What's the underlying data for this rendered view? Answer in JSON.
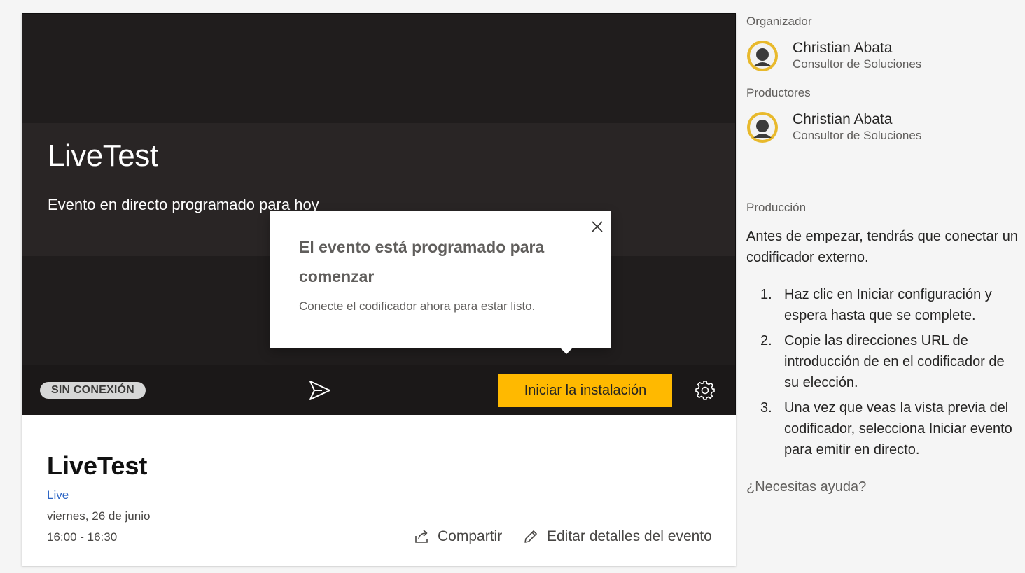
{
  "player": {
    "banner_title": "LiveTest",
    "banner_subtitle": "Evento en directo programado para hoy",
    "status": "SIN CONEXIÓN",
    "start_button": "Iniciar la instalación",
    "accent": "#ffb900"
  },
  "popup": {
    "title": "El evento está programado para comenzar",
    "text": "Conecte el codificador ahora para estar listo."
  },
  "event": {
    "title": "LiveTest",
    "type": "Live",
    "date": "viernes, 26 de junio",
    "time": "16:00 - 16:30",
    "share_label": "Compartir",
    "edit_label": "Editar detalles del evento"
  },
  "side": {
    "organizer_label": "Organizador",
    "organizer": {
      "name": "Christian Abata",
      "role": "Consultor de Soluciones"
    },
    "producers_label": "Productores",
    "producer": {
      "name": "Christian Abata",
      "role": "Consultor de Soluciones"
    },
    "production_label": "Producción",
    "intro": "Antes de empezar, tendrás que conectar un codificador externo.",
    "steps": [
      {
        "num": "1.",
        "text": "Haz clic en Iniciar configuración y espera hasta que se complete."
      },
      {
        "num": "2.",
        "text": "Copie las direcciones URL de introducción de  en el codificador de su elección."
      },
      {
        "num": "3.",
        "text": "Una vez que veas la vista previa del codificador, selecciona Iniciar evento para emitir en directo."
      }
    ],
    "help": "¿Necesitas ayuda?"
  }
}
